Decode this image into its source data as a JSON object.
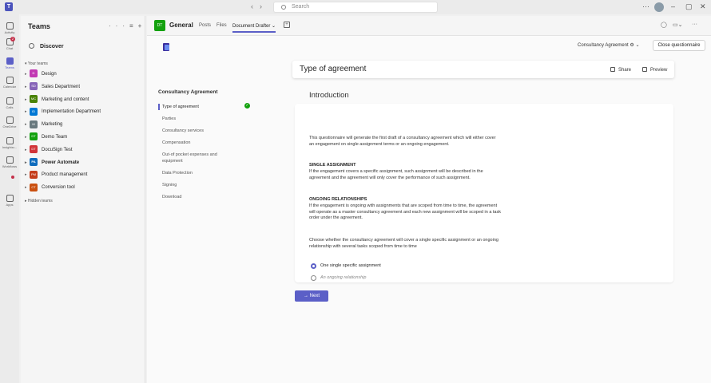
{
  "app": {
    "search_placeholder": "Search",
    "logo_text": "T"
  },
  "rail": [
    {
      "label": "Activity",
      "icon": "bell-icon"
    },
    {
      "label": "Chat",
      "icon": "chat-icon",
      "badge": "2"
    },
    {
      "label": "Teams",
      "icon": "teams-icon",
      "active": true
    },
    {
      "label": "Calendar",
      "icon": "calendar-icon"
    },
    {
      "label": "Calls",
      "icon": "phone-icon"
    },
    {
      "label": "OneDrive",
      "icon": "cloud-icon"
    },
    {
      "label": "Insightsr...",
      "icon": "download-icon"
    },
    {
      "label": "Workflows",
      "icon": "workflow-icon"
    },
    {
      "label": "Apps",
      "icon": "apps-icon"
    }
  ],
  "teams_panel": {
    "title": "Teams",
    "discover": "Discover",
    "your_teams_label": "Your teams",
    "hidden_teams_label": "Hidden teams",
    "teams": [
      {
        "name": "Design",
        "abbr": "D",
        "color": "#c239b3",
        "bold": false
      },
      {
        "name": "Sales Department",
        "abbr": "SD",
        "color": "#8764b8",
        "bold": false
      },
      {
        "name": "Marketing and content",
        "abbr": "MC",
        "color": "#498205",
        "bold": false
      },
      {
        "name": "Implementation Department",
        "abbr": "ID",
        "color": "#0078d4",
        "bold": false
      },
      {
        "name": "Marketing",
        "abbr": "M",
        "color": "#69797e",
        "bold": false
      },
      {
        "name": "Demo Team",
        "abbr": "DT",
        "color": "#13a10e",
        "bold": false
      },
      {
        "name": "DocuSign Test",
        "abbr": "DT",
        "color": "#d13438",
        "bold": false
      },
      {
        "name": "Power Automate",
        "abbr": "PA",
        "color": "#0f6cbd",
        "bold": true
      },
      {
        "name": "Product management",
        "abbr": "PM",
        "color": "#c43e1c",
        "bold": false
      },
      {
        "name": "Conversion tool",
        "abbr": "CT",
        "color": "#ca5010",
        "bold": false
      }
    ]
  },
  "channel": {
    "avatar": "DT",
    "name": "General",
    "tabs": [
      {
        "label": "Posts",
        "active": false
      },
      {
        "label": "Files",
        "active": false
      },
      {
        "label": "Document Drafter",
        "active": true
      }
    ]
  },
  "toolbar": {
    "agreement_select": "Consultancy Agreement",
    "close_label": "Close questionnaire",
    "header_title": "Type of agreement",
    "share_label": "Share",
    "preview_label": "Preview",
    "next_label": "Next"
  },
  "nav": {
    "title": "Consultancy Agreement",
    "items": [
      "Type of agreement",
      "Parties",
      "Consultancy services",
      "Compensation",
      "Out-of pocket expenses and equipment",
      "Data Protection",
      "Signing",
      "Download"
    ]
  },
  "content": {
    "section_title": "Introduction",
    "intro_paragraph": "This questionnaire will generate the first draft of a consultancy agreement which will either cover an engagement on single assignment terms or an ongoing engagement.",
    "single_heading": "SINGLE ASSIGNMENT",
    "single_text": "If the engagement covers a specific assignment, such assignment will be described in the agreement and the agreement will only cover the performance of such assignment.",
    "ongoing_heading": "ONGOING RELATIONSHIPS",
    "ongoing_text": "If the engagement is ongoing with assignments that are scoped from time to time, the agreement will operate as a master consultancy agreement and each new assignment will be scoped in a task order under the agreement.",
    "question": "Choose whether the consultancy agreement will cover a single specific assignment or an ongoing relationship with several tasks scoped from time to time",
    "options": [
      {
        "label": "One single specific assignment",
        "selected": true
      },
      {
        "label": "An ongoing relationship",
        "selected": false
      }
    ]
  }
}
